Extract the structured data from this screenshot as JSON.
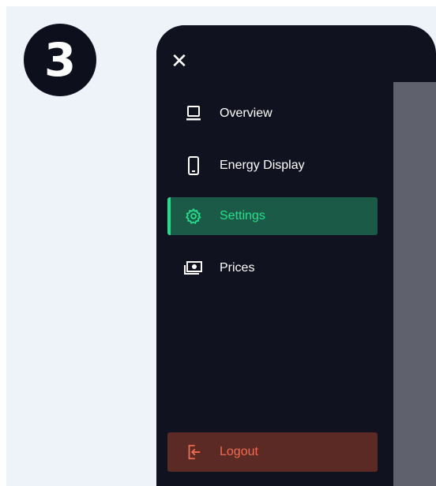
{
  "step": {
    "number": "3"
  },
  "drawer": {
    "close_glyph": "✕",
    "items": [
      {
        "label": "Overview",
        "icon": "monitor-icon",
        "active": false
      },
      {
        "label": "Energy Display",
        "icon": "smartphone-icon",
        "active": false
      },
      {
        "label": "Settings",
        "icon": "gear-icon",
        "active": true
      },
      {
        "label": "Prices",
        "icon": "banknote-icon",
        "active": false
      }
    ],
    "logout": {
      "label": "Logout",
      "icon": "logout-icon"
    }
  },
  "colors": {
    "drawer_bg": "#10121f",
    "accent": "#22e08a",
    "active_bg": "#1c5a48",
    "logout_bg": "#5b2a24",
    "logout_fg": "#ef6c52",
    "page_bg": "#eef2f9"
  }
}
